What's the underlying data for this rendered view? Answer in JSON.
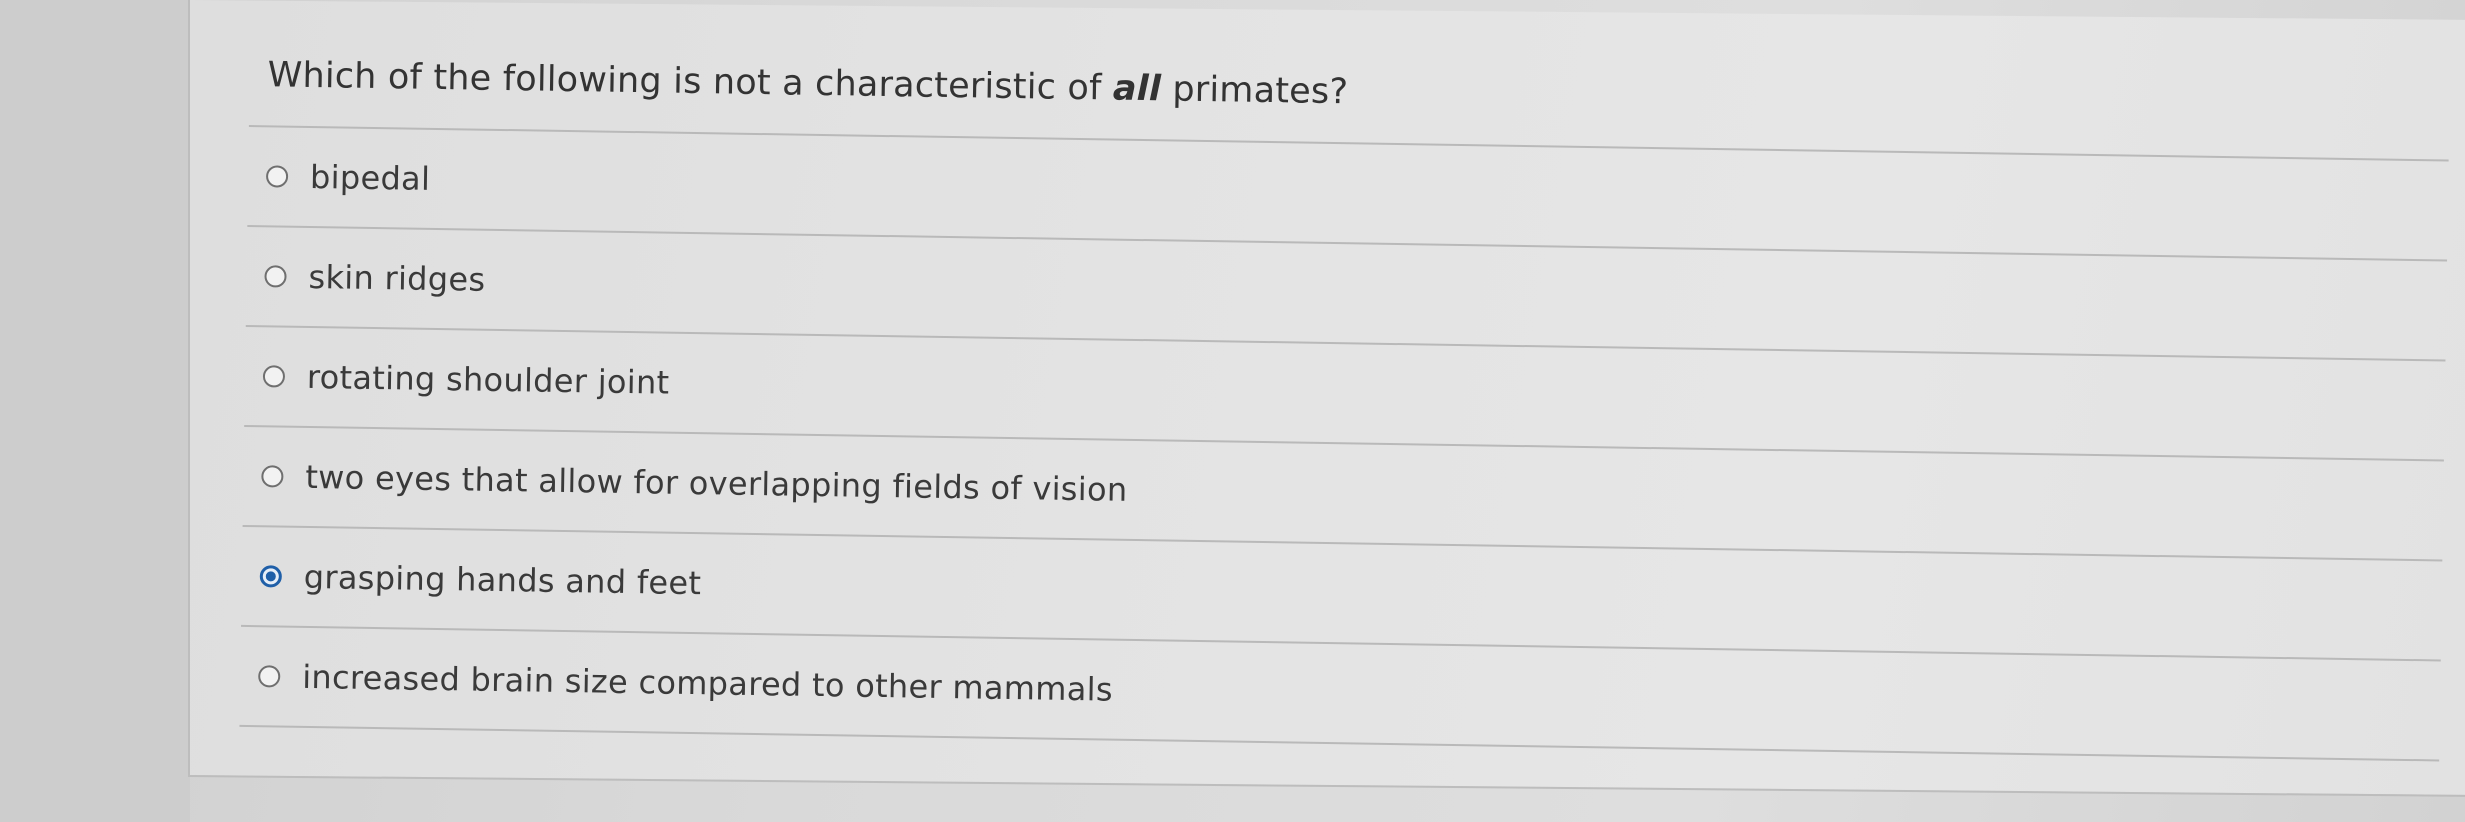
{
  "question": {
    "text_before": "Which of the following is not a characteristic of",
    "emphasis": "all",
    "text_after": "primates?"
  },
  "options": [
    {
      "label": "bipedal",
      "selected": false
    },
    {
      "label": "skin ridges",
      "selected": false
    },
    {
      "label": "rotating shoulder joint",
      "selected": false
    },
    {
      "label": "two eyes that allow for overlapping fields of vision",
      "selected": false
    },
    {
      "label": "grasping hands and feet",
      "selected": true
    },
    {
      "label": "increased brain size compared to other mammals",
      "selected": false
    }
  ],
  "colors": {
    "selected_radio": "#1f5fa8",
    "text": "#333333"
  }
}
